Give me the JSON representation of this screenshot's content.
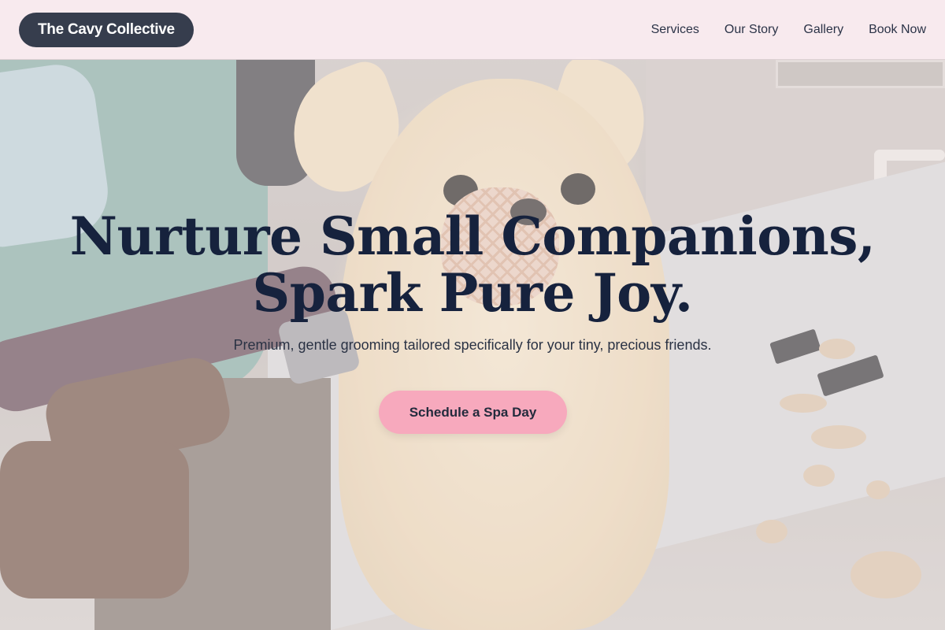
{
  "header": {
    "brand": "The Cavy Collective",
    "nav": [
      {
        "label": "Services"
      },
      {
        "label": "Our Story"
      },
      {
        "label": "Gallery"
      },
      {
        "label": "Book Now"
      }
    ]
  },
  "hero": {
    "headline_line1": "Nurture Small Companions,",
    "headline_line2": "Spark Pure Joy.",
    "subtitle": "Premium, gentle grooming tailored specifically for your tiny, precious friends.",
    "cta_label": "Schedule a Spa Day",
    "image_subject": "small fluffy dog wearing a muzzle being groomed with clippers"
  },
  "colors": {
    "brand_pill": "#363d4d",
    "accent_pink": "#f7a9bd",
    "header_bg": "#faecf0",
    "headline": "#16223d"
  }
}
